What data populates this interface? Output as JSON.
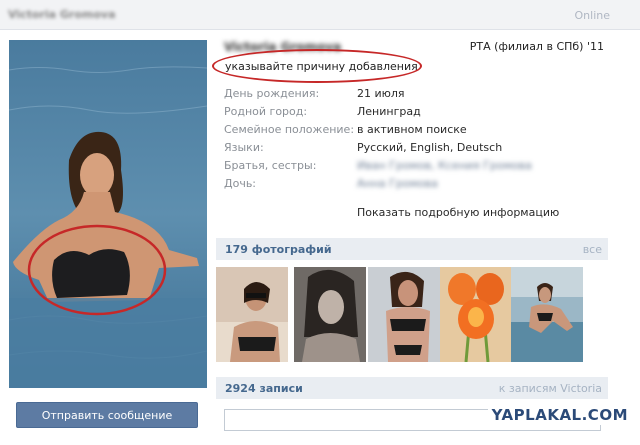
{
  "header": {
    "user_name": "Victoria Gromova",
    "status_online": "Online"
  },
  "profile": {
    "name": "Victoria Gromova",
    "school": "РТА (филиал в СПб) '11",
    "status": "указывайте причину добавления",
    "fields": [
      {
        "label": "День рождения:",
        "value": "21 июля",
        "blurred": false
      },
      {
        "label": "Родной город:",
        "value": "Ленинград",
        "blurred": false
      },
      {
        "label": "Семейное положение:",
        "value": "в активном поиске",
        "blurred": false
      },
      {
        "label": "Языки:",
        "value": "Русский, English, Deutsch",
        "blurred": false
      },
      {
        "label": "Братья, сестры:",
        "value": "Иван Громов, Ксения Громова",
        "blurred": true
      },
      {
        "label": "Дочь:",
        "value": "Анна Громова",
        "blurred": true
      }
    ],
    "show_more": "Показать подробную информацию",
    "send_message": "Отправить сообщение"
  },
  "photos": {
    "title": "179 фотографий",
    "link": "все",
    "count": 5
  },
  "wall": {
    "title": "2924 записи",
    "link": "к записям Victoria",
    "placeholder": ""
  },
  "watermark": "YAPLAKAL.COM",
  "colors": {
    "accent": "#45688e",
    "button": "#5d7ba3",
    "annotation": "#c62828"
  }
}
